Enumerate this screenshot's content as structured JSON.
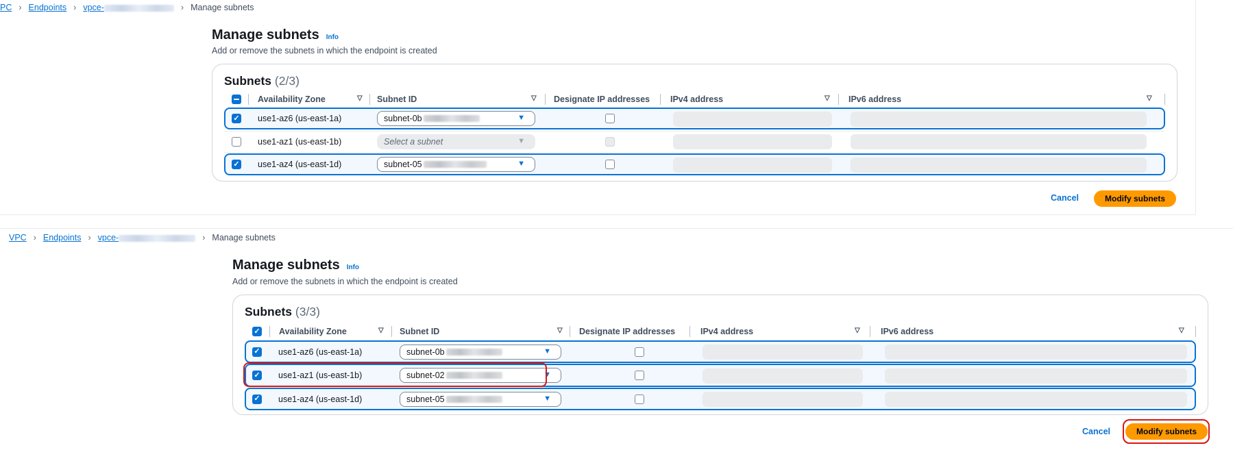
{
  "top": {
    "breadcrumb": {
      "vpc": "PC",
      "endpoints": "Endpoints",
      "vpce": "vpce-",
      "current": "Manage subnets"
    },
    "title": "Manage subnets",
    "info": "Info",
    "description": "Add or remove the subnets in which the endpoint is created",
    "container_title": "Subnets",
    "count": " (2/3)",
    "columns": {
      "az": "Availability Zone",
      "subnet": "Subnet ID",
      "designate": "Designate IP addresses",
      "ipv4": "IPv4 address",
      "ipv6": "IPv6 address"
    },
    "rows": [
      {
        "az": "use1-az6 (us-east-1a)",
        "subnet": "subnet-0b",
        "checked": true
      },
      {
        "az": "use1-az1 (us-east-1b)",
        "subnet": "Select a subnet",
        "checked": false
      },
      {
        "az": "use1-az4 (us-east-1d)",
        "subnet": "subnet-05",
        "checked": true
      }
    ],
    "cancel": "Cancel",
    "modify": "Modify subnets"
  },
  "bottom": {
    "breadcrumb": {
      "vpc": "VPC",
      "endpoints": "Endpoints",
      "vpce": "vpce-",
      "current": "Manage subnets"
    },
    "title": "Manage subnets",
    "info": "Info",
    "description": "Add or remove the subnets in which the endpoint is created",
    "container_title": "Subnets",
    "count": " (3/3)",
    "columns": {
      "az": "Availability Zone",
      "subnet": "Subnet ID",
      "designate": "Designate IP addresses",
      "ipv4": "IPv4 address",
      "ipv6": "IPv6 address"
    },
    "rows": [
      {
        "az": "use1-az6 (us-east-1a)",
        "subnet": "subnet-0b",
        "checked": true
      },
      {
        "az": "use1-az1 (us-east-1b)",
        "subnet": "subnet-02",
        "checked": true
      },
      {
        "az": "use1-az4 (us-east-1d)",
        "subnet": "subnet-05",
        "checked": true
      }
    ],
    "cancel": "Cancel",
    "modify": "Modify subnets"
  },
  "icons": {
    "sort": "sort-down-icon",
    "caret": "caret-down-icon",
    "check": "check-icon",
    "chevron": "chevron-right-icon"
  },
  "colors": {
    "link": "#0972d3",
    "primary": "#ff9900",
    "highlight": "#d91515",
    "selected_row_bg": "#f2f8fd"
  }
}
